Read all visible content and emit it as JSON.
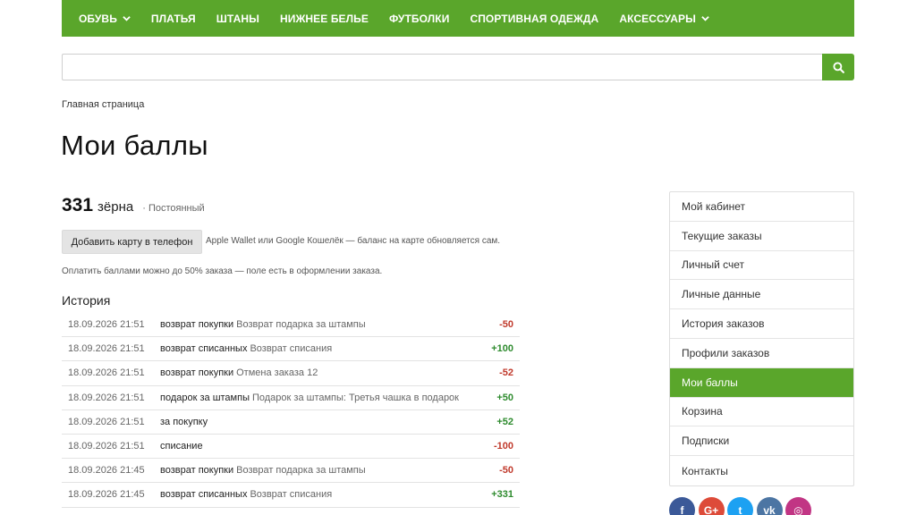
{
  "nav": {
    "items": [
      {
        "label": "ОБУВЬ",
        "dropdown": true
      },
      {
        "label": "ПЛАТЬЯ",
        "dropdown": false
      },
      {
        "label": "ШТАНЫ",
        "dropdown": false
      },
      {
        "label": "НИЖНЕЕ БЕЛЬЕ",
        "dropdown": false
      },
      {
        "label": "ФУТБОЛКИ",
        "dropdown": false
      },
      {
        "label": "СПОРТИВНАЯ ОДЕЖДА",
        "dropdown": false
      },
      {
        "label": "АКСЕССУАРЫ",
        "dropdown": true
      }
    ]
  },
  "search": {
    "value": "",
    "placeholder": "",
    "icon": "search-icon"
  },
  "breadcrumb": "Главная страница",
  "page_title": "Мои баллы",
  "points": {
    "value": "331",
    "unit": "зёрна",
    "level": "· Постоянный"
  },
  "wallet": {
    "button": "Добавить карту в телефон",
    "note": "Apple Wallet или Google Кошелёк — баланс на карте обновляется сам."
  },
  "pay_note": "Оплатить баллами можно до 50% заказа — поле есть в оформлении заказа.",
  "history": {
    "title": "История",
    "rows": [
      {
        "date": "18.09.2026 21:51",
        "type": "возврат покупки",
        "desc": "Возврат подарка за штампы",
        "amount": "-50"
      },
      {
        "date": "18.09.2026 21:51",
        "type": "возврат списанных",
        "desc": "Возврат списания",
        "amount": "+100"
      },
      {
        "date": "18.09.2026 21:51",
        "type": "возврат покупки",
        "desc": "Отмена заказа 12",
        "amount": "-52"
      },
      {
        "date": "18.09.2026 21:51",
        "type": "подарок за штампы",
        "desc": "Подарок за штампы: Третья чашка в подарок",
        "amount": "+50"
      },
      {
        "date": "18.09.2026 21:51",
        "type": "за покупку",
        "desc": "",
        "amount": "+52"
      },
      {
        "date": "18.09.2026 21:51",
        "type": "списание",
        "desc": "",
        "amount": "-100"
      },
      {
        "date": "18.09.2026 21:45",
        "type": "возврат покупки",
        "desc": "Возврат подарка за штампы",
        "amount": "-50"
      },
      {
        "date": "18.09.2026 21:45",
        "type": "возврат списанных",
        "desc": "Возврат списания",
        "amount": "+331"
      }
    ]
  },
  "sidebar": {
    "items": [
      {
        "label": "Мой кабинет",
        "active": false
      },
      {
        "label": "Текущие заказы",
        "active": false
      },
      {
        "label": "Личный счет",
        "active": false
      },
      {
        "label": "Личные данные",
        "active": false
      },
      {
        "label": "История заказов",
        "active": false
      },
      {
        "label": "Профили заказов",
        "active": false
      },
      {
        "label": "Мои баллы",
        "active": true
      },
      {
        "label": "Корзина",
        "active": false
      },
      {
        "label": "Подписки",
        "active": false
      },
      {
        "label": "Контакты",
        "active": false
      }
    ]
  },
  "social": [
    {
      "name": "facebook-icon",
      "glyph": "f",
      "color": "#3b5998"
    },
    {
      "name": "google-plus-icon",
      "glyph": "G+",
      "color": "#dd4b39"
    },
    {
      "name": "twitter-icon",
      "glyph": "t",
      "color": "#1da1f2"
    },
    {
      "name": "vk-icon",
      "glyph": "vk",
      "color": "#4c75a3"
    },
    {
      "name": "instagram-icon",
      "glyph": "◎",
      "color": "#c13584"
    }
  ],
  "colors": {
    "accent": "#5aa62b",
    "negative": "#c0392b",
    "positive": "#2e8b2e"
  }
}
